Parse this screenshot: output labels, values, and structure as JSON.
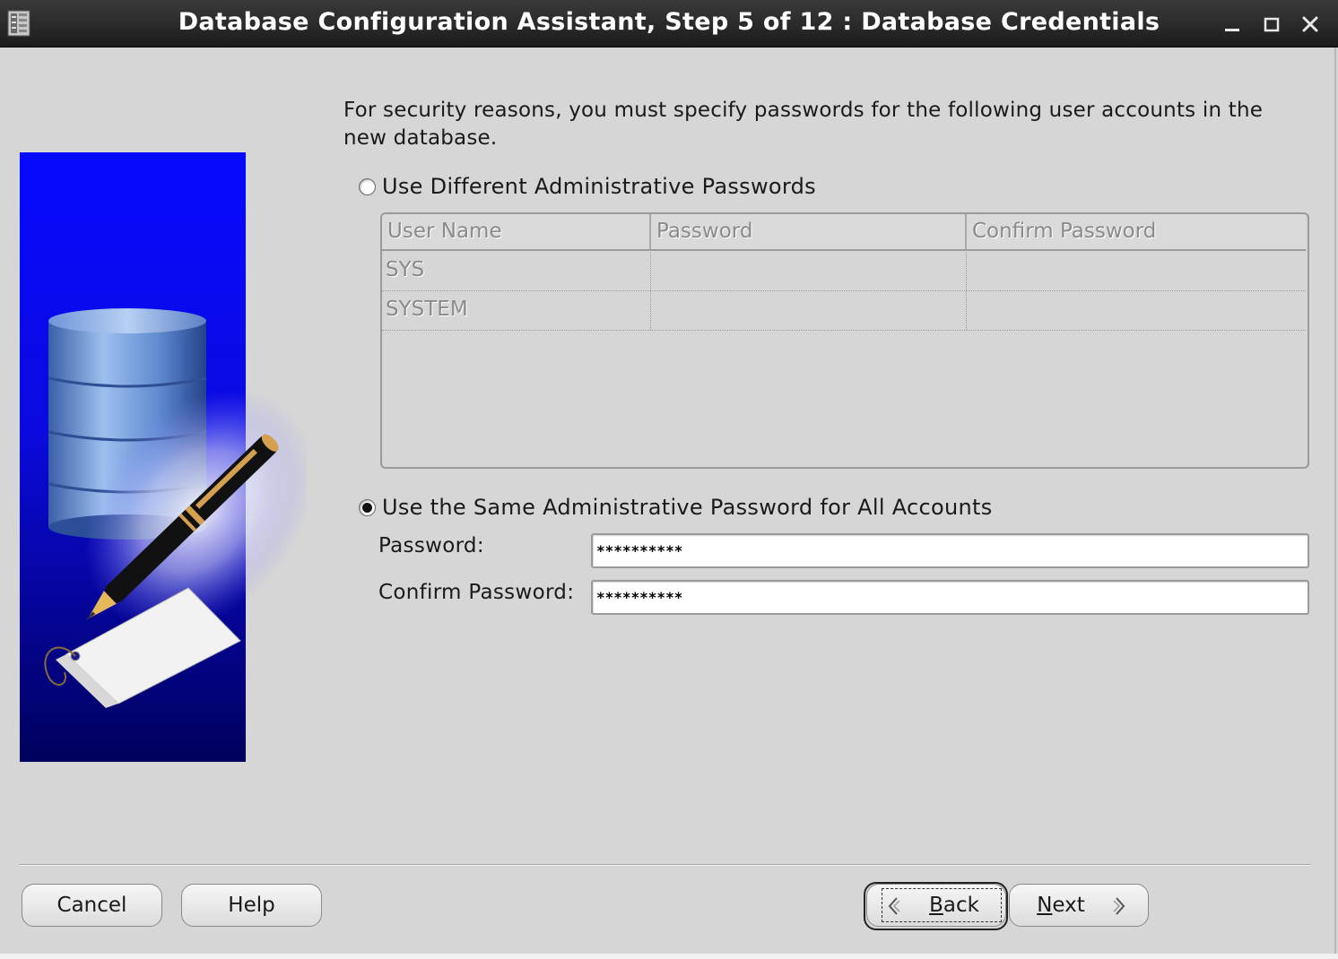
{
  "window": {
    "title": "Database Configuration Assistant, Step 5 of 12 : Database Credentials",
    "controls": [
      "minimize",
      "maximize",
      "close"
    ]
  },
  "instruction": "For security reasons, you must specify passwords for the following user accounts in the new database.",
  "option_different": {
    "label": "Use Different Administrative Passwords",
    "selected": false
  },
  "table": {
    "columns": [
      "User Name",
      "Password",
      "Confirm Password"
    ],
    "rows": [
      {
        "user": "SYS",
        "password": "",
        "confirm": ""
      },
      {
        "user": "SYSTEM",
        "password": "",
        "confirm": ""
      }
    ],
    "enabled": false
  },
  "option_same": {
    "label": "Use the Same Administrative Password for All Accounts",
    "selected": true
  },
  "password_field": {
    "label": "Password:",
    "value": "**********"
  },
  "confirm_field": {
    "label": "Confirm Password:",
    "value": "**********"
  },
  "buttons": {
    "cancel": "Cancel",
    "help": "Help",
    "back_mnemonic": "B",
    "back_rest": "ack",
    "next_mnemonic": "N",
    "next_rest": "ext"
  },
  "colors": {
    "titlebar": "#1c1c1c",
    "window_bg": "#d6d6d6",
    "illustration_blue": "#0a0af5",
    "illustration_navy": "#000068"
  }
}
